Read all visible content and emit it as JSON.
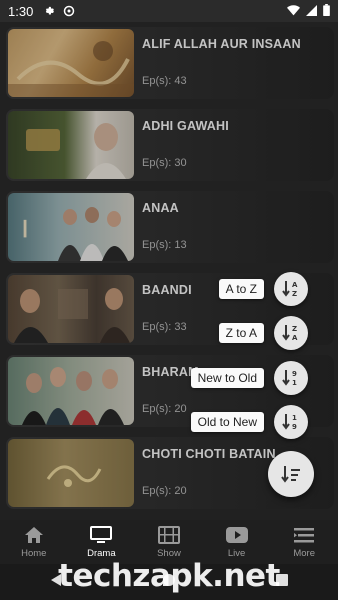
{
  "status_bar": {
    "time": "1:30"
  },
  "dramas": [
    {
      "title": "ALIF ALLAH AUR INSAAN",
      "episodes": "Ep(s): 43"
    },
    {
      "title": "ADHI GAWAHI",
      "episodes": "Ep(s): 30"
    },
    {
      "title": "ANAA",
      "episodes": "Ep(s): 13"
    },
    {
      "title": "BAANDI",
      "episodes": "Ep(s): 33"
    },
    {
      "title": "BHARAM",
      "episodes": "Ep(s): 20"
    },
    {
      "title": "CHOTI CHOTI BATAIN",
      "episodes": "Ep(s): 20"
    }
  ],
  "sort_menu": {
    "a_to_z": "A to Z",
    "z_to_a": "Z to A",
    "new_to_old": "New to Old",
    "old_to_new": "Old to New"
  },
  "bottom_nav": {
    "home": "Home",
    "drama": "Drama",
    "show": "Show",
    "live": "Live",
    "more": "More"
  },
  "watermark": "techzapk.net"
}
